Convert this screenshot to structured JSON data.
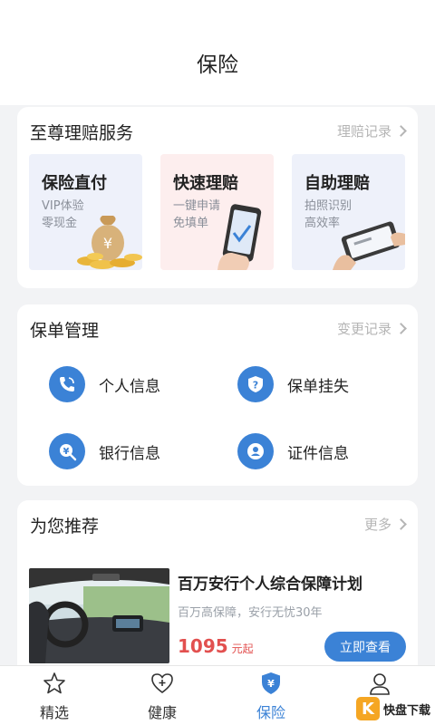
{
  "header": {
    "title": "保险"
  },
  "claims": {
    "title": "至尊理赔服务",
    "link": "理赔记录",
    "tiles": [
      {
        "title": "保险直付",
        "line1": "VIP体验",
        "line2": "零现金",
        "bg": "#eef1fa"
      },
      {
        "title": "快速理赔",
        "line1": "一键申请",
        "line2": "免填单",
        "bg": "#fdeeee"
      },
      {
        "title": "自助理赔",
        "line1": "拍照识别",
        "line2": "高效率",
        "bg": "#eef1fa"
      }
    ]
  },
  "policy": {
    "title": "保单管理",
    "link": "变更记录",
    "items": [
      {
        "label": "个人信息",
        "icon": "phone-icon"
      },
      {
        "label": "保单挂失",
        "icon": "shield-question-icon"
      },
      {
        "label": "银行信息",
        "icon": "yen-search-icon"
      },
      {
        "label": "证件信息",
        "icon": "id-person-icon"
      }
    ]
  },
  "recommend": {
    "title": "为您推荐",
    "link": "更多",
    "product": {
      "name": "百万安行个人综合保障计划",
      "desc": "百万高保障，安行无忧30年",
      "price": "1095",
      "price_unit": "元起",
      "button": "立即查看"
    }
  },
  "tabbar": {
    "items": [
      {
        "label": "精选",
        "icon": "star-icon"
      },
      {
        "label": "健康",
        "icon": "heart-plus-icon"
      },
      {
        "label": "保险",
        "icon": "shield-yen-icon",
        "active": true
      },
      {
        "label": "",
        "icon": "user-icon"
      }
    ]
  },
  "watermark": {
    "k": "K",
    "text": "快盘下载"
  },
  "colors": {
    "accent": "#3b82d6",
    "price": "#e2504f"
  }
}
